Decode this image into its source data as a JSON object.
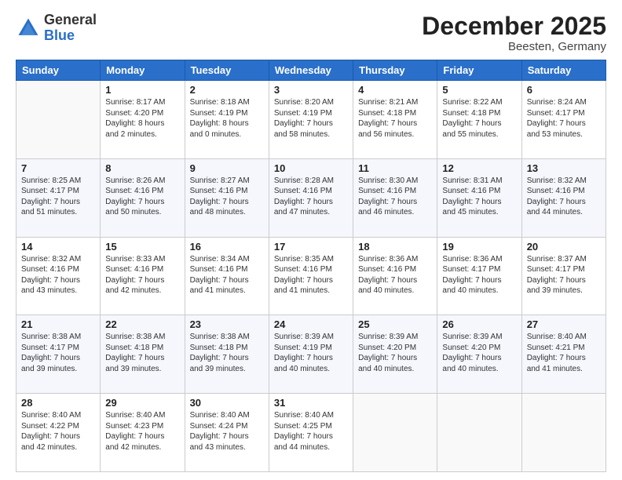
{
  "logo": {
    "general": "General",
    "blue": "Blue"
  },
  "header": {
    "month": "December 2025",
    "location": "Beesten, Germany"
  },
  "weekdays": [
    "Sunday",
    "Monday",
    "Tuesday",
    "Wednesday",
    "Thursday",
    "Friday",
    "Saturday"
  ],
  "weeks": [
    [
      {
        "day": "",
        "info": ""
      },
      {
        "day": "1",
        "info": "Sunrise: 8:17 AM\nSunset: 4:20 PM\nDaylight: 8 hours\nand 2 minutes."
      },
      {
        "day": "2",
        "info": "Sunrise: 8:18 AM\nSunset: 4:19 PM\nDaylight: 8 hours\nand 0 minutes."
      },
      {
        "day": "3",
        "info": "Sunrise: 8:20 AM\nSunset: 4:19 PM\nDaylight: 7 hours\nand 58 minutes."
      },
      {
        "day": "4",
        "info": "Sunrise: 8:21 AM\nSunset: 4:18 PM\nDaylight: 7 hours\nand 56 minutes."
      },
      {
        "day": "5",
        "info": "Sunrise: 8:22 AM\nSunset: 4:18 PM\nDaylight: 7 hours\nand 55 minutes."
      },
      {
        "day": "6",
        "info": "Sunrise: 8:24 AM\nSunset: 4:17 PM\nDaylight: 7 hours\nand 53 minutes."
      }
    ],
    [
      {
        "day": "7",
        "info": "Sunrise: 8:25 AM\nSunset: 4:17 PM\nDaylight: 7 hours\nand 51 minutes."
      },
      {
        "day": "8",
        "info": "Sunrise: 8:26 AM\nSunset: 4:16 PM\nDaylight: 7 hours\nand 50 minutes."
      },
      {
        "day": "9",
        "info": "Sunrise: 8:27 AM\nSunset: 4:16 PM\nDaylight: 7 hours\nand 48 minutes."
      },
      {
        "day": "10",
        "info": "Sunrise: 8:28 AM\nSunset: 4:16 PM\nDaylight: 7 hours\nand 47 minutes."
      },
      {
        "day": "11",
        "info": "Sunrise: 8:30 AM\nSunset: 4:16 PM\nDaylight: 7 hours\nand 46 minutes."
      },
      {
        "day": "12",
        "info": "Sunrise: 8:31 AM\nSunset: 4:16 PM\nDaylight: 7 hours\nand 45 minutes."
      },
      {
        "day": "13",
        "info": "Sunrise: 8:32 AM\nSunset: 4:16 PM\nDaylight: 7 hours\nand 44 minutes."
      }
    ],
    [
      {
        "day": "14",
        "info": "Sunrise: 8:32 AM\nSunset: 4:16 PM\nDaylight: 7 hours\nand 43 minutes."
      },
      {
        "day": "15",
        "info": "Sunrise: 8:33 AM\nSunset: 4:16 PM\nDaylight: 7 hours\nand 42 minutes."
      },
      {
        "day": "16",
        "info": "Sunrise: 8:34 AM\nSunset: 4:16 PM\nDaylight: 7 hours\nand 41 minutes."
      },
      {
        "day": "17",
        "info": "Sunrise: 8:35 AM\nSunset: 4:16 PM\nDaylight: 7 hours\nand 41 minutes."
      },
      {
        "day": "18",
        "info": "Sunrise: 8:36 AM\nSunset: 4:16 PM\nDaylight: 7 hours\nand 40 minutes."
      },
      {
        "day": "19",
        "info": "Sunrise: 8:36 AM\nSunset: 4:17 PM\nDaylight: 7 hours\nand 40 minutes."
      },
      {
        "day": "20",
        "info": "Sunrise: 8:37 AM\nSunset: 4:17 PM\nDaylight: 7 hours\nand 39 minutes."
      }
    ],
    [
      {
        "day": "21",
        "info": "Sunrise: 8:38 AM\nSunset: 4:17 PM\nDaylight: 7 hours\nand 39 minutes."
      },
      {
        "day": "22",
        "info": "Sunrise: 8:38 AM\nSunset: 4:18 PM\nDaylight: 7 hours\nand 39 minutes."
      },
      {
        "day": "23",
        "info": "Sunrise: 8:38 AM\nSunset: 4:18 PM\nDaylight: 7 hours\nand 39 minutes."
      },
      {
        "day": "24",
        "info": "Sunrise: 8:39 AM\nSunset: 4:19 PM\nDaylight: 7 hours\nand 40 minutes."
      },
      {
        "day": "25",
        "info": "Sunrise: 8:39 AM\nSunset: 4:20 PM\nDaylight: 7 hours\nand 40 minutes."
      },
      {
        "day": "26",
        "info": "Sunrise: 8:39 AM\nSunset: 4:20 PM\nDaylight: 7 hours\nand 40 minutes."
      },
      {
        "day": "27",
        "info": "Sunrise: 8:40 AM\nSunset: 4:21 PM\nDaylight: 7 hours\nand 41 minutes."
      }
    ],
    [
      {
        "day": "28",
        "info": "Sunrise: 8:40 AM\nSunset: 4:22 PM\nDaylight: 7 hours\nand 42 minutes."
      },
      {
        "day": "29",
        "info": "Sunrise: 8:40 AM\nSunset: 4:23 PM\nDaylight: 7 hours\nand 42 minutes."
      },
      {
        "day": "30",
        "info": "Sunrise: 8:40 AM\nSunset: 4:24 PM\nDaylight: 7 hours\nand 43 minutes."
      },
      {
        "day": "31",
        "info": "Sunrise: 8:40 AM\nSunset: 4:25 PM\nDaylight: 7 hours\nand 44 minutes."
      },
      {
        "day": "",
        "info": ""
      },
      {
        "day": "",
        "info": ""
      },
      {
        "day": "",
        "info": ""
      }
    ]
  ]
}
